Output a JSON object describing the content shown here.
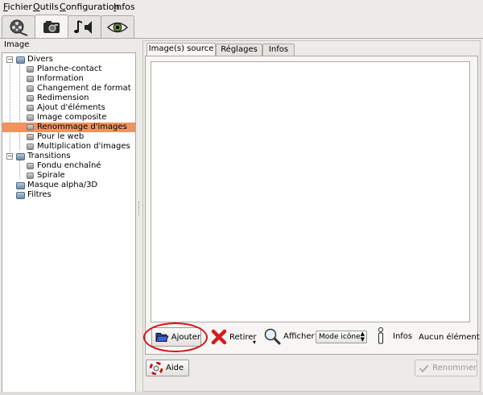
{
  "menu": {
    "items": [
      {
        "label": "Fichier"
      },
      {
        "label": "Outils"
      },
      {
        "label": "Configuration"
      },
      {
        "label": "Infos"
      }
    ]
  },
  "toolbar": {
    "tabs": [
      {
        "icon": "film-reel-icon"
      },
      {
        "icon": "camera-image-icon",
        "active": true
      },
      {
        "icon": "music-speaker-icon"
      },
      {
        "icon": "eye-icon"
      }
    ]
  },
  "left_panel": {
    "header": "Image",
    "tree": [
      {
        "label": "Divers",
        "level": 0,
        "expanded": true
      },
      {
        "label": "Planche-contact",
        "level": 1
      },
      {
        "label": "Information",
        "level": 1
      },
      {
        "label": "Changement de format",
        "level": 1
      },
      {
        "label": "Redimension",
        "level": 1
      },
      {
        "label": "Ajout d'éléments",
        "level": 1
      },
      {
        "label": "Image composite",
        "level": 1
      },
      {
        "label": "Renommage d'images",
        "level": 1,
        "selected": true
      },
      {
        "label": "Pour le web",
        "level": 1
      },
      {
        "label": "Multiplication d'images",
        "level": 1
      },
      {
        "label": "Transitions",
        "level": 0,
        "expanded": true
      },
      {
        "label": "Fondu enchaîné",
        "level": 1
      },
      {
        "label": "Spirale",
        "level": 1
      },
      {
        "label": "Masque alpha/3D",
        "level": 0
      },
      {
        "label": "Filtres",
        "level": 0
      }
    ],
    "selection_color": "#f0935f"
  },
  "notebook": {
    "tabs": [
      {
        "label": "Image(s) source",
        "active": true
      },
      {
        "label": "Réglages"
      },
      {
        "label": "Infos"
      }
    ]
  },
  "actions": {
    "add_label": "Ajouter",
    "remove_label": "Retirer",
    "show_label": "Afficher",
    "mode_value": "Mode icône",
    "info_label": "Infos",
    "status_label": "Aucun élément"
  },
  "bottom": {
    "help_label": "Aide",
    "rename_label": "Renommer"
  },
  "colors": {
    "highlight_circle": "#d8131b"
  }
}
